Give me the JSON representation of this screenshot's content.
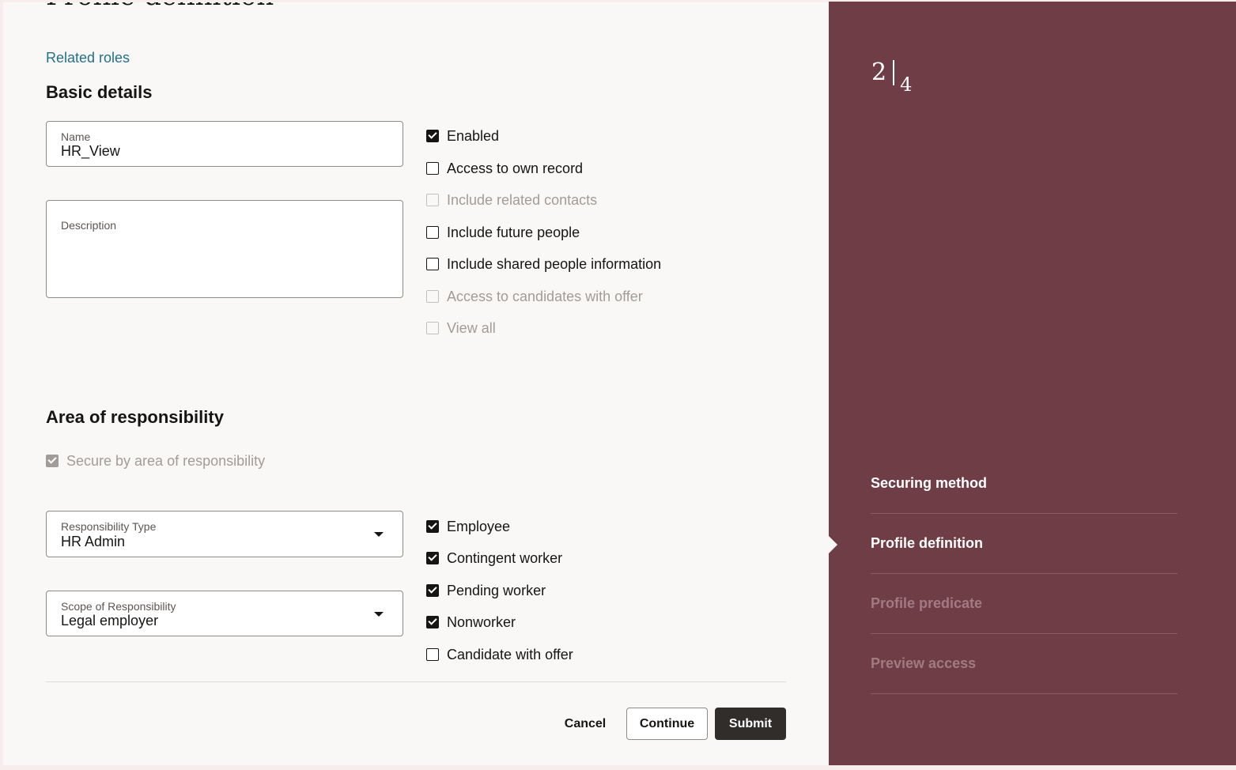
{
  "page": {
    "title": "Profile definition",
    "related_roles_link": "Related roles"
  },
  "basic_details": {
    "heading": "Basic details",
    "name_label": "Name",
    "name_value": "HR_View",
    "description_label": "Description",
    "description_value": "",
    "options": [
      {
        "label": "Enabled",
        "checked": true,
        "disabled": false
      },
      {
        "label": "Access to own record",
        "checked": false,
        "disabled": false
      },
      {
        "label": "Include related contacts",
        "checked": false,
        "disabled": true
      },
      {
        "label": "Include future people",
        "checked": false,
        "disabled": false
      },
      {
        "label": "Include shared people information",
        "checked": false,
        "disabled": false
      },
      {
        "label": "Access to candidates with offer",
        "checked": false,
        "disabled": true
      },
      {
        "label": "View all",
        "checked": false,
        "disabled": true
      }
    ]
  },
  "area_of_responsibility": {
    "heading": "Area of responsibility",
    "secure_checkbox": {
      "label": "Secure by area of responsibility",
      "checked": true,
      "disabled": true
    },
    "responsibility_type_label": "Responsibility Type",
    "responsibility_type_value": "HR Admin",
    "scope_label": "Scope of Responsibility",
    "scope_value": "Legal employer",
    "worker_types": [
      {
        "label": "Employee",
        "checked": true
      },
      {
        "label": "Contingent worker",
        "checked": true
      },
      {
        "label": "Pending worker",
        "checked": true
      },
      {
        "label": "Nonworker",
        "checked": true
      },
      {
        "label": "Candidate with offer",
        "checked": false
      }
    ]
  },
  "actions": {
    "cancel": "Cancel",
    "continue": "Continue",
    "submit": "Submit"
  },
  "sidebar": {
    "current_step": "2",
    "total_steps": "4",
    "steps": [
      {
        "label": "Securing method",
        "state": "done"
      },
      {
        "label": "Profile definition",
        "state": "active"
      },
      {
        "label": "Profile predicate",
        "state": "future"
      },
      {
        "label": "Preview access",
        "state": "future"
      }
    ]
  },
  "colors": {
    "sidebar_bg": "#6f3d46",
    "link": "#22708a",
    "primary_button": "#312d2a",
    "page_bg": "#faf8f6"
  }
}
